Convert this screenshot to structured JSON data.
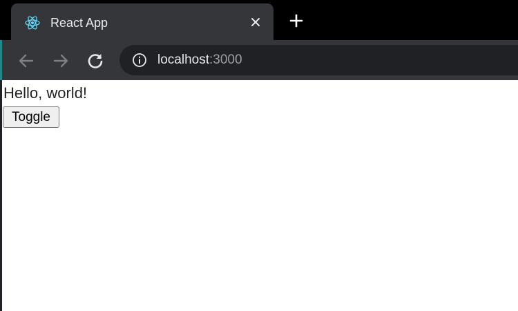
{
  "browser": {
    "tab": {
      "title": "React App",
      "icon": "react-logo-icon"
    },
    "new_tab_icon": "plus-icon",
    "close_icon": "close-icon",
    "nav": {
      "back_icon": "arrow-left-icon",
      "forward_icon": "arrow-right-icon",
      "reload_icon": "reload-icon"
    },
    "address": {
      "info_icon": "info-icon",
      "host": "localhost",
      "port": ":3000"
    },
    "colors": {
      "tabstrip": "#000000",
      "toolbar": "#35363a",
      "omnibox": "#202124",
      "text": "#e8eaed",
      "react_accent": "#61dafb"
    }
  },
  "page": {
    "heading": "Hello, world!",
    "toggle_label": "Toggle"
  }
}
